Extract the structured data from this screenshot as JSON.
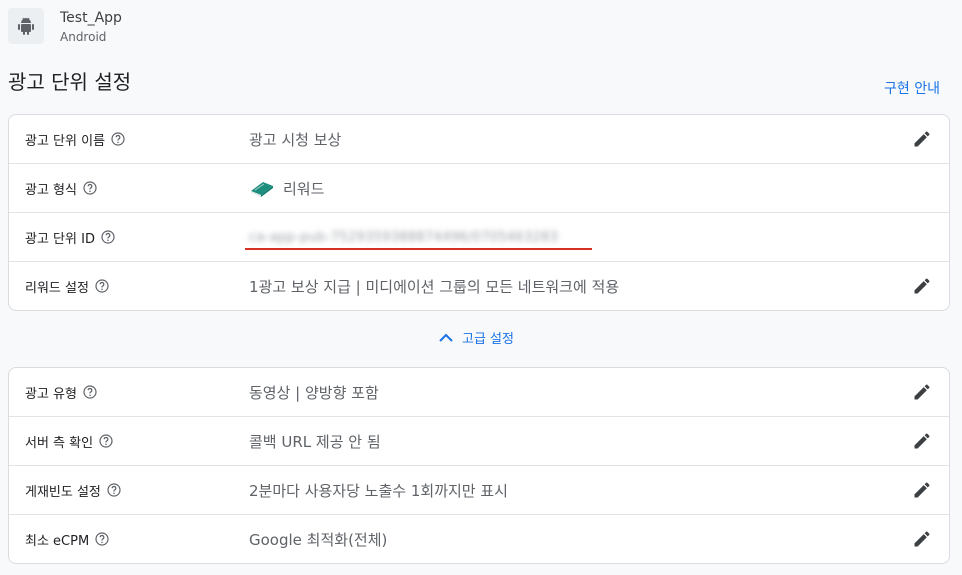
{
  "app": {
    "name": "Test_App",
    "platform": "Android",
    "icon": "android-icon"
  },
  "page": {
    "title": "광고 단위 설정",
    "impl_guide_link": "구현 안내"
  },
  "basic_settings": {
    "ad_unit_name": {
      "label": "광고 단위 이름",
      "value": "광고 시청 보상"
    },
    "ad_format": {
      "label": "광고 형식",
      "value": "리워드",
      "icon": "reward-book-icon"
    },
    "ad_unit_id": {
      "label": "광고 단위 ID",
      "value": "ca-app-pub-7529359388874496/0705463283"
    },
    "reward_settings": {
      "label": "리워드 설정",
      "value": "1광고 보상 지급 | 미디에이션 그룹의 모든 네트워크에 적용"
    }
  },
  "advanced_toggle": {
    "label": "고급 설정",
    "icon": "chevron-up-icon"
  },
  "advanced_settings": {
    "ad_type": {
      "label": "광고 유형",
      "value": "동영상 | 양방향 포함"
    },
    "server_verification": {
      "label": "서버 측 확인",
      "value": "콜백 URL 제공 안 됨"
    },
    "frequency_cap": {
      "label": "게재빈도 설정",
      "value": "2분마다 사용자당 노출수 1회까지만 표시"
    },
    "min_ecpm": {
      "label": "최소 eCPM",
      "value": "Google 최적화(전체)"
    }
  },
  "colors": {
    "accent": "#1a73e8",
    "underline": "#d93025",
    "text_secondary": "#5f6368"
  }
}
